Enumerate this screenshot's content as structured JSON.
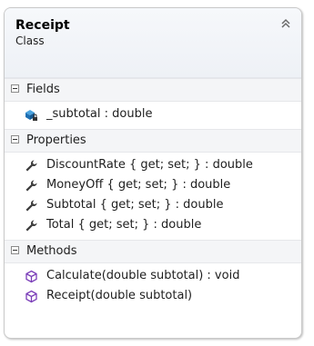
{
  "class_card": {
    "title": "Receipt",
    "subtitle": "Class",
    "collapse_icon": "double-chevron-up-icon"
  },
  "sections": {
    "fields": {
      "label": "Fields",
      "items": [
        {
          "text": "_subtotal : double",
          "icon": "private-field-icon"
        }
      ]
    },
    "properties": {
      "label": "Properties",
      "items": [
        {
          "text": "DiscountRate { get; set; } : double",
          "icon": "wrench-icon"
        },
        {
          "text": "MoneyOff { get; set; } : double",
          "icon": "wrench-icon"
        },
        {
          "text": "Subtotal { get; set; } : double",
          "icon": "wrench-icon"
        },
        {
          "text": "Total { get; set; } : double",
          "icon": "wrench-icon"
        }
      ]
    },
    "methods": {
      "label": "Methods",
      "items": [
        {
          "text": "Calculate(double subtotal) : void",
          "icon": "method-cube-icon"
        },
        {
          "text": "Receipt(double subtotal)",
          "icon": "method-cube-icon"
        }
      ]
    }
  },
  "colors": {
    "method_icon": "#7a3db8",
    "field_icon": "#1f6fb2",
    "wrench_icon": "#3c3c3c"
  }
}
